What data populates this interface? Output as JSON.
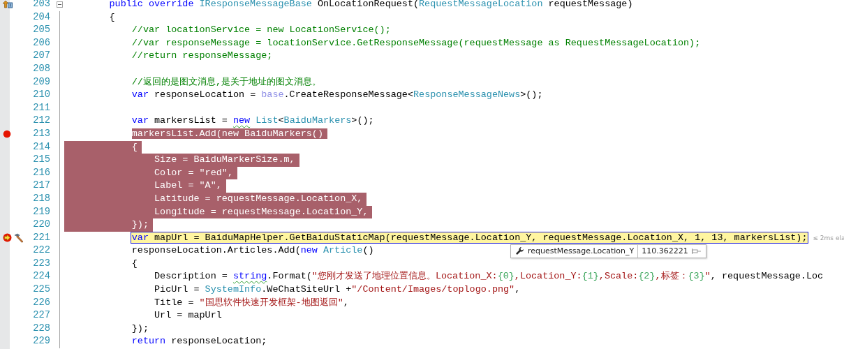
{
  "editor": {
    "lines": [
      {
        "number": "203",
        "glyphs": [
          {
            "kind": "override"
          }
        ],
        "fold": {
          "expanded": true
        },
        "selected": false,
        "current": false,
        "tokens": [
          {
            "kind": "kw",
            "t": "        public override"
          },
          {
            "kind": "type",
            "t": " IResponseMessageBase"
          },
          {
            "kind": "p",
            "t": " OnLocationRequest("
          },
          {
            "kind": "type",
            "t": "RequestMessageLocation"
          },
          {
            "kind": "p",
            "t": " requestMessage)"
          }
        ]
      },
      {
        "number": "204",
        "selected": false,
        "current": false,
        "tokens": [
          {
            "kind": "p",
            "t": "        {"
          }
        ]
      },
      {
        "number": "205",
        "selected": false,
        "current": false,
        "tokens": [
          {
            "kind": "comment",
            "t": "            //var locationService = new LocationService();"
          }
        ]
      },
      {
        "number": "206",
        "selected": false,
        "current": false,
        "tokens": [
          {
            "kind": "comment",
            "t": "            //var responseMessage = locationService.GetResponseMessage(requestMessage as RequestMessageLocation);"
          }
        ]
      },
      {
        "number": "207",
        "selected": false,
        "current": false,
        "tokens": [
          {
            "kind": "comment",
            "t": "            //return responseMessage;"
          }
        ]
      },
      {
        "number": "208",
        "selected": false,
        "current": false
      },
      {
        "number": "209",
        "selected": false,
        "current": false,
        "tokens": [
          {
            "kind": "comment",
            "t": "            //返回的是图文消息,是关于地址的图文消息。"
          }
        ]
      },
      {
        "number": "210",
        "selected": false,
        "current": false,
        "tokens": [
          {
            "kind": "kw",
            "t": "            var"
          },
          {
            "kind": "p",
            "t": " responseLocation ="
          },
          {
            "kind": "base",
            "t": " base"
          },
          {
            "kind": "p",
            "t": ".CreateResponseMessage<"
          },
          {
            "kind": "type",
            "t": "ResponseMessageNews"
          },
          {
            "kind": "p",
            "t": ">();"
          }
        ]
      },
      {
        "number": "211",
        "selected": false,
        "current": false
      },
      {
        "number": "212",
        "selected": false,
        "current": false,
        "tokens": [
          {
            "kind": "kw",
            "t": "            var"
          },
          {
            "kind": "p",
            "t": " markersList = "
          },
          {
            "kind": "kw",
            "t": "new",
            "squiggle": true
          },
          {
            "kind": "type",
            "t": " List"
          },
          {
            "kind": "p",
            "t": "<"
          },
          {
            "kind": "type",
            "t": "BaiduMarkers"
          },
          {
            "kind": "p",
            "t": ">();"
          }
        ]
      },
      {
        "number": "213",
        "glyphs": [
          {
            "kind": "breakpoint"
          }
        ],
        "selected": true,
        "current": false,
        "tokens": [
          {
            "kind": "p",
            "t": "            markersList.Add("
          },
          {
            "kind": "kw",
            "t": "new"
          },
          {
            "kind": "type",
            "t": " BaiduMarkers"
          },
          {
            "kind": "p",
            "t": "()"
          }
        ]
      },
      {
        "number": "214",
        "selected": true,
        "current": false,
        "tokens": [
          {
            "kind": "p",
            "t": "            {"
          }
        ]
      },
      {
        "number": "215",
        "selected": true,
        "current": false,
        "tokens": [
          {
            "kind": "p",
            "t": "                Size = BaiduMarkerSize.m,"
          }
        ]
      },
      {
        "number": "216",
        "selected": true,
        "current": false,
        "tokens": [
          {
            "kind": "p",
            "t": "                Color ="
          },
          {
            "kind": "str",
            "t": " \"red\""
          },
          {
            "kind": "p",
            "t": ","
          }
        ]
      },
      {
        "number": "217",
        "selected": true,
        "current": false,
        "tokens": [
          {
            "kind": "p",
            "t": "                Label ="
          },
          {
            "kind": "str",
            "t": " \"A\""
          },
          {
            "kind": "p",
            "t": ","
          }
        ]
      },
      {
        "number": "218",
        "selected": true,
        "current": false,
        "tokens": [
          {
            "kind": "p",
            "t": "                Latitude = requestMessage.Location_X,"
          }
        ]
      },
      {
        "number": "219",
        "selected": true,
        "current": false,
        "tokens": [
          {
            "kind": "p",
            "t": "                Longitude = requestMessage.Location_Y,"
          }
        ]
      },
      {
        "number": "220",
        "selected": true,
        "current": false,
        "tokens": [
          {
            "kind": "p",
            "t": "            });"
          }
        ]
      },
      {
        "number": "221",
        "glyphs": [
          {
            "kind": "breakpoint_current"
          },
          {
            "kind": "edit"
          }
        ],
        "selected": false,
        "current": true,
        "tokens": [
          {
            "kind": "kw",
            "t": "            var"
          },
          {
            "kind": "p",
            "t": " mapUrl = BaiduMapHelper.GetBaiduStaticMap(requestMessage.Location_Y, requestMessage.Location_X, 1, 13, markersList);"
          }
        ],
        "perf_tip": "≤ 2ms ela",
        "data_tip": {
          "expression": "requestMessage.Location_Y",
          "value": "110.362221"
        }
      },
      {
        "number": "222",
        "selected": false,
        "current": false,
        "tokens": [
          {
            "kind": "p",
            "t": "            responseLocation.Articles.Add("
          },
          {
            "kind": "kw",
            "t": "new"
          },
          {
            "kind": "type",
            "t": " Article"
          },
          {
            "kind": "p",
            "t": "()"
          }
        ]
      },
      {
        "number": "223",
        "selected": false,
        "current": false,
        "tokens": [
          {
            "kind": "p",
            "t": "            {"
          }
        ]
      },
      {
        "number": "224",
        "selected": false,
        "current": false,
        "tokens": [
          {
            "kind": "p",
            "t": "                Description = "
          },
          {
            "kind": "kw",
            "t": "string",
            "squiggle": true
          },
          {
            "kind": "p",
            "t": ".Format("
          },
          {
            "kind": "str",
            "t": "\"您刚才发送了地理位置信息。Location_X:"
          },
          {
            "kind": "fmt",
            "t": "{0}"
          },
          {
            "kind": "str",
            "t": ",Location_Y:"
          },
          {
            "kind": "fmt",
            "t": "{1}"
          },
          {
            "kind": "str",
            "t": ",Scale:"
          },
          {
            "kind": "fmt",
            "t": "{2}"
          },
          {
            "kind": "str",
            "t": ",标签："
          },
          {
            "kind": "fmt",
            "t": "{3}"
          },
          {
            "kind": "str",
            "t": "\""
          },
          {
            "kind": "p",
            "t": ", requestMessage.Loc"
          }
        ]
      },
      {
        "number": "225",
        "selected": false,
        "current": false,
        "tokens": [
          {
            "kind": "p",
            "t": "                PicUrl ="
          },
          {
            "kind": "type",
            "t": " SystemInfo"
          },
          {
            "kind": "p",
            "t": ".WeChatSiteUrl +"
          },
          {
            "kind": "str",
            "t": "\"/Content/Images/toplogo.png\""
          },
          {
            "kind": "p",
            "t": ","
          }
        ]
      },
      {
        "number": "226",
        "selected": false,
        "current": false,
        "tokens": [
          {
            "kind": "p",
            "t": "                Title ="
          },
          {
            "kind": "str",
            "t": " \"国思软件快速开发框架-地图返回\""
          },
          {
            "kind": "p",
            "t": ","
          }
        ]
      },
      {
        "number": "227",
        "selected": false,
        "current": false,
        "tokens": [
          {
            "kind": "p",
            "t": "                Url = mapUrl"
          }
        ]
      },
      {
        "number": "228",
        "selected": false,
        "current": false,
        "tokens": [
          {
            "kind": "p",
            "t": "            });"
          }
        ]
      },
      {
        "number": "229",
        "selected": false,
        "current": false,
        "tokens": [
          {
            "kind": "kw",
            "t": "            return"
          },
          {
            "kind": "p",
            "t": " responseLocation;"
          }
        ]
      }
    ]
  }
}
